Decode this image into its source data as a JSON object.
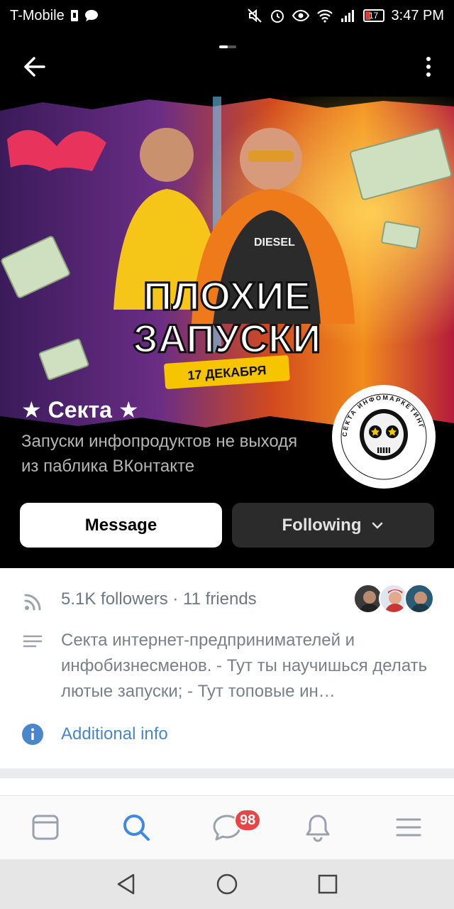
{
  "status_bar": {
    "carrier": "T-Mobile",
    "battery_level": "17",
    "time": "3:47 PM"
  },
  "cover": {
    "poster_title_line1": "ПЛОХИЕ",
    "poster_title_line2": "ЗАПУСКИ",
    "poster_date": "17 ДЕКАБРЯ",
    "shirt_text": "DIESEL"
  },
  "group": {
    "name": "★ Секта ★",
    "status": "Запуски инфопродуктов не выходя из паблика ВКонтакте",
    "avatar_ring_text": "СЕКТА ИНФОМАРКЕТИНГ"
  },
  "actions": {
    "message_label": "Message",
    "following_label": "Following"
  },
  "info": {
    "followers_text": "5.1K followers · 11 friends",
    "description": "Секта интернет-предпринимателей и инфобизнесменов.  - Тут ты научишься делать лютые запуски; - Тут топовые ин…",
    "additional_info_label": "Additional info"
  },
  "bottom_nav": {
    "items": [
      "news-icon",
      "search-icon",
      "messages-icon",
      "notifications-icon",
      "menu-icon"
    ],
    "messages_badge": "98"
  },
  "colors": {
    "accent": "#4986cc",
    "badge": "#e64646",
    "button_dark": "#2b2b2b",
    "poster_yellow": "#f7c400"
  }
}
